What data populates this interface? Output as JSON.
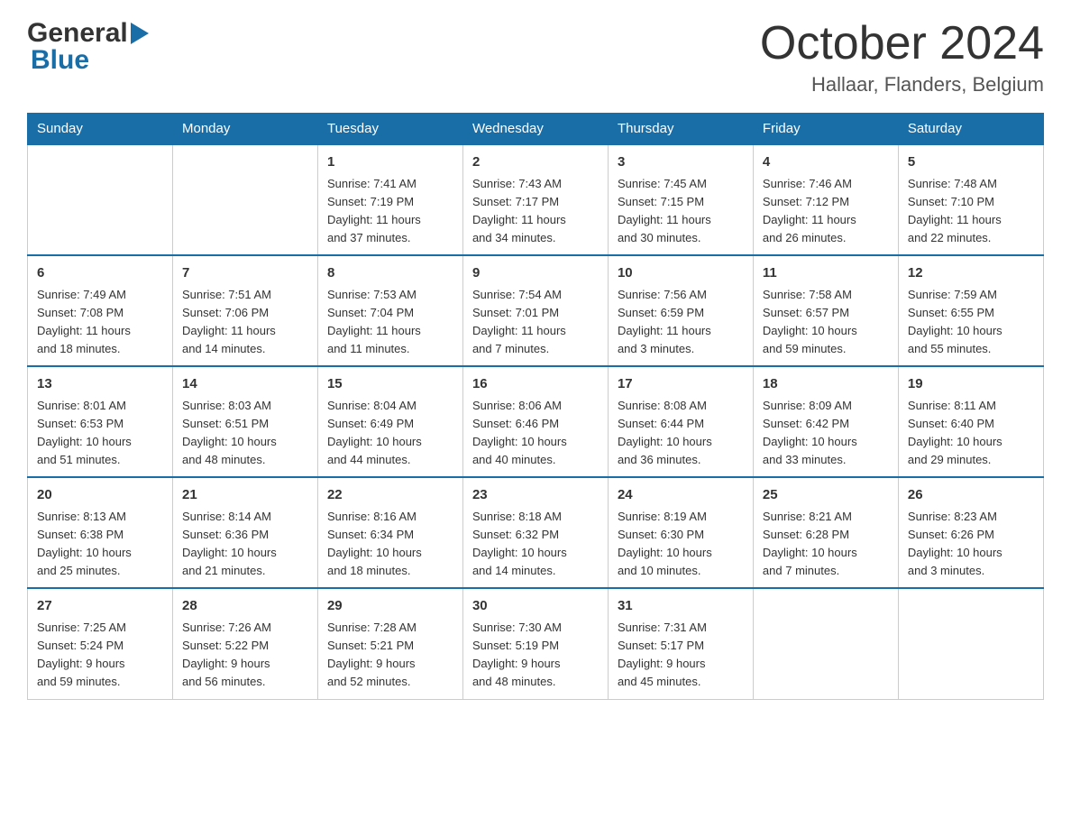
{
  "header": {
    "logo_line1": "General",
    "logo_line2": "Blue",
    "title": "October 2024",
    "location": "Hallaar, Flanders, Belgium"
  },
  "calendar": {
    "days_of_week": [
      "Sunday",
      "Monday",
      "Tuesday",
      "Wednesday",
      "Thursday",
      "Friday",
      "Saturday"
    ],
    "weeks": [
      [
        {
          "day": "",
          "info": ""
        },
        {
          "day": "",
          "info": ""
        },
        {
          "day": "1",
          "info": "Sunrise: 7:41 AM\nSunset: 7:19 PM\nDaylight: 11 hours\nand 37 minutes."
        },
        {
          "day": "2",
          "info": "Sunrise: 7:43 AM\nSunset: 7:17 PM\nDaylight: 11 hours\nand 34 minutes."
        },
        {
          "day": "3",
          "info": "Sunrise: 7:45 AM\nSunset: 7:15 PM\nDaylight: 11 hours\nand 30 minutes."
        },
        {
          "day": "4",
          "info": "Sunrise: 7:46 AM\nSunset: 7:12 PM\nDaylight: 11 hours\nand 26 minutes."
        },
        {
          "day": "5",
          "info": "Sunrise: 7:48 AM\nSunset: 7:10 PM\nDaylight: 11 hours\nand 22 minutes."
        }
      ],
      [
        {
          "day": "6",
          "info": "Sunrise: 7:49 AM\nSunset: 7:08 PM\nDaylight: 11 hours\nand 18 minutes."
        },
        {
          "day": "7",
          "info": "Sunrise: 7:51 AM\nSunset: 7:06 PM\nDaylight: 11 hours\nand 14 minutes."
        },
        {
          "day": "8",
          "info": "Sunrise: 7:53 AM\nSunset: 7:04 PM\nDaylight: 11 hours\nand 11 minutes."
        },
        {
          "day": "9",
          "info": "Sunrise: 7:54 AM\nSunset: 7:01 PM\nDaylight: 11 hours\nand 7 minutes."
        },
        {
          "day": "10",
          "info": "Sunrise: 7:56 AM\nSunset: 6:59 PM\nDaylight: 11 hours\nand 3 minutes."
        },
        {
          "day": "11",
          "info": "Sunrise: 7:58 AM\nSunset: 6:57 PM\nDaylight: 10 hours\nand 59 minutes."
        },
        {
          "day": "12",
          "info": "Sunrise: 7:59 AM\nSunset: 6:55 PM\nDaylight: 10 hours\nand 55 minutes."
        }
      ],
      [
        {
          "day": "13",
          "info": "Sunrise: 8:01 AM\nSunset: 6:53 PM\nDaylight: 10 hours\nand 51 minutes."
        },
        {
          "day": "14",
          "info": "Sunrise: 8:03 AM\nSunset: 6:51 PM\nDaylight: 10 hours\nand 48 minutes."
        },
        {
          "day": "15",
          "info": "Sunrise: 8:04 AM\nSunset: 6:49 PM\nDaylight: 10 hours\nand 44 minutes."
        },
        {
          "day": "16",
          "info": "Sunrise: 8:06 AM\nSunset: 6:46 PM\nDaylight: 10 hours\nand 40 minutes."
        },
        {
          "day": "17",
          "info": "Sunrise: 8:08 AM\nSunset: 6:44 PM\nDaylight: 10 hours\nand 36 minutes."
        },
        {
          "day": "18",
          "info": "Sunrise: 8:09 AM\nSunset: 6:42 PM\nDaylight: 10 hours\nand 33 minutes."
        },
        {
          "day": "19",
          "info": "Sunrise: 8:11 AM\nSunset: 6:40 PM\nDaylight: 10 hours\nand 29 minutes."
        }
      ],
      [
        {
          "day": "20",
          "info": "Sunrise: 8:13 AM\nSunset: 6:38 PM\nDaylight: 10 hours\nand 25 minutes."
        },
        {
          "day": "21",
          "info": "Sunrise: 8:14 AM\nSunset: 6:36 PM\nDaylight: 10 hours\nand 21 minutes."
        },
        {
          "day": "22",
          "info": "Sunrise: 8:16 AM\nSunset: 6:34 PM\nDaylight: 10 hours\nand 18 minutes."
        },
        {
          "day": "23",
          "info": "Sunrise: 8:18 AM\nSunset: 6:32 PM\nDaylight: 10 hours\nand 14 minutes."
        },
        {
          "day": "24",
          "info": "Sunrise: 8:19 AM\nSunset: 6:30 PM\nDaylight: 10 hours\nand 10 minutes."
        },
        {
          "day": "25",
          "info": "Sunrise: 8:21 AM\nSunset: 6:28 PM\nDaylight: 10 hours\nand 7 minutes."
        },
        {
          "day": "26",
          "info": "Sunrise: 8:23 AM\nSunset: 6:26 PM\nDaylight: 10 hours\nand 3 minutes."
        }
      ],
      [
        {
          "day": "27",
          "info": "Sunrise: 7:25 AM\nSunset: 5:24 PM\nDaylight: 9 hours\nand 59 minutes."
        },
        {
          "day": "28",
          "info": "Sunrise: 7:26 AM\nSunset: 5:22 PM\nDaylight: 9 hours\nand 56 minutes."
        },
        {
          "day": "29",
          "info": "Sunrise: 7:28 AM\nSunset: 5:21 PM\nDaylight: 9 hours\nand 52 minutes."
        },
        {
          "day": "30",
          "info": "Sunrise: 7:30 AM\nSunset: 5:19 PM\nDaylight: 9 hours\nand 48 minutes."
        },
        {
          "day": "31",
          "info": "Sunrise: 7:31 AM\nSunset: 5:17 PM\nDaylight: 9 hours\nand 45 minutes."
        },
        {
          "day": "",
          "info": ""
        },
        {
          "day": "",
          "info": ""
        }
      ]
    ]
  }
}
